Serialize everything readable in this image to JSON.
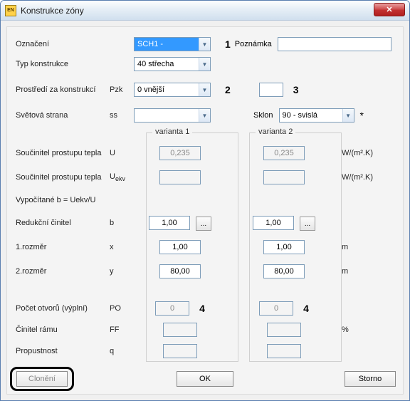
{
  "window": {
    "title": "Konstrukce zóny"
  },
  "labels": {
    "oznaceni": "Označení",
    "typkon": "Typ konstrukce",
    "prostredi": "Prostředí za konstrukcí",
    "svetova": "Světová strana",
    "poznamka": "Poznámka",
    "sklon": "Sklon",
    "varianta1": "varianta 1",
    "varianta2": "varianta 2",
    "sou_u": "Součinitel prostupu tepla",
    "sou_uekv": "Součinitel prostupu tepla",
    "vypoc": "Vypočítané b = Uekv/U",
    "redukcni": "Redukční činitel",
    "rozm1": "1.rozměr",
    "rozm2": "2.rozměr",
    "pocet": "Počet otvorů (výplní)",
    "cinitel": "Činitel rámu",
    "propust": "Propustnost",
    "cloneni_btn": "Clonění",
    "ok": "OK",
    "storno": "Storno"
  },
  "symbols": {
    "pzk": "Pzk",
    "ss": "ss",
    "u": "U",
    "uekv": "U",
    "uekv_sub": "ekv",
    "b": "b",
    "x": "x",
    "y": "y",
    "po": "PO",
    "ff": "FF",
    "q": "q"
  },
  "values": {
    "oznaceni": "SCH1  -",
    "typkon": "40 střecha",
    "prostredi": "0 vnější",
    "svetova": "",
    "sklon": "90 - svislá",
    "poznamka": ""
  },
  "variant1": {
    "u": "0,235",
    "uekv": "",
    "b": "1,00",
    "x": "1,00",
    "y": "80,00",
    "po": "0",
    "ff": "",
    "q": ""
  },
  "variant2": {
    "u": "0,235",
    "uekv": "",
    "b": "1,00",
    "x": "1,00",
    "y": "80,00",
    "po": "0",
    "ff": "",
    "q": ""
  },
  "units": {
    "wm2k": "W/(m².K)",
    "m": "m",
    "pct": "%"
  },
  "annot": {
    "n1": "1",
    "n2": "2",
    "n3": "3",
    "n4": "4",
    "star": "*"
  },
  "misc": {
    "dots": "..."
  }
}
